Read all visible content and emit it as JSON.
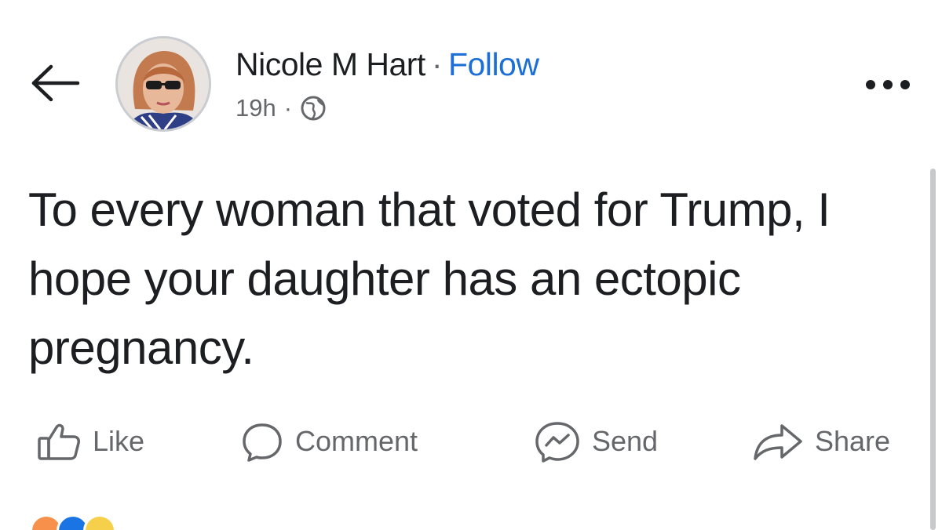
{
  "header": {
    "back_icon": "arrow-left-icon",
    "author_name": "Nicole M Hart",
    "separator": "·",
    "follow_label": "Follow",
    "timestamp": "19h",
    "meta_separator": "·",
    "audience_icon": "globe-icon",
    "more_icon": "more-horizontal-icon"
  },
  "post": {
    "text": "To every woman that voted for Trump, I hope your daughter has an ectopic pregnancy."
  },
  "actions": [
    {
      "label": "Like",
      "icon": "thumbs-up-icon"
    },
    {
      "label": "Comment",
      "icon": "comment-bubble-icon"
    },
    {
      "label": "Send",
      "icon": "messenger-icon"
    },
    {
      "label": "Share",
      "icon": "share-arrow-icon"
    }
  ],
  "reactions": {
    "icons": [
      "haha-reaction-icon",
      "like-reaction-icon",
      "care-reaction-icon"
    ],
    "colors": [
      "#f7904b",
      "#1b74e4",
      "#f7d04b"
    ]
  },
  "colors": {
    "link_blue": "#1b6fd6",
    "text": "#1c1e21",
    "secondary_text": "#65676b"
  }
}
